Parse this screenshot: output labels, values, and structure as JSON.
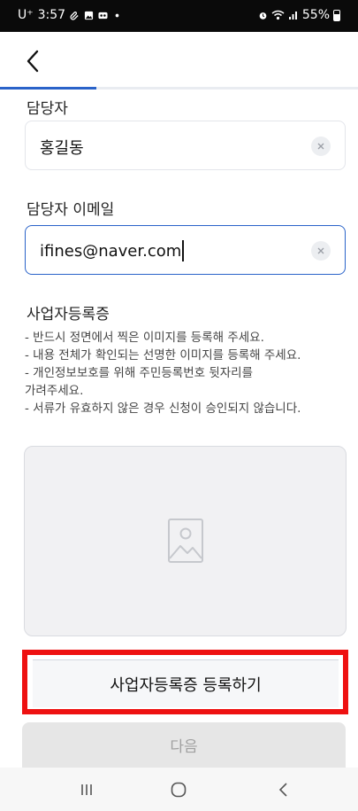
{
  "status_bar": {
    "carrier": "U⁺",
    "time": "3:57",
    "battery": "55%",
    "icons": [
      "attachment-icon",
      "image-icon",
      "voicemail-icon",
      "dot-icon",
      "alarm-icon",
      "wifi-icon",
      "signal-icon",
      "battery-icon"
    ]
  },
  "header": {
    "back_icon": "chevron-left-icon"
  },
  "progress": {
    "fraction": 0.27,
    "color": "#2a63c9"
  },
  "form": {
    "manager_label": "담당자",
    "manager_value": "홍길동",
    "email_label": "담당자 이메일",
    "email_value": "ifines@naver.com",
    "cert_label": "사업자등록증",
    "notes": [
      "- 반드시 정면에서 찍은 이미지를 등록해 주세요.",
      "- 내용 전체가 확인되는 선명한 이미지를 등록해 주세요.",
      "- 개인정보보호를 위해 주민등록번호 뒷자리를",
      "가려주세요.",
      "- 서류가 유효하지 않은 경우 신청이 승인되지 않습니다."
    ]
  },
  "buttons": {
    "register_label": "사업자등록증 등록하기",
    "next_label": "다음"
  },
  "colors": {
    "accent": "#2a63c9",
    "highlight": "#ee1111",
    "disabled_bg": "#e6e6e6",
    "disabled_text": "#a0a0a0"
  },
  "nav_bar": {
    "icons": [
      "recent-apps-icon",
      "home-icon",
      "back-icon"
    ]
  }
}
